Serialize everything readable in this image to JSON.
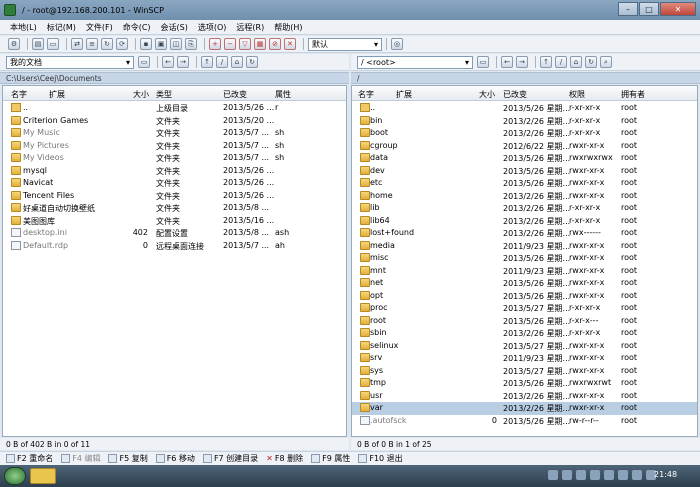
{
  "window": {
    "title": "/ - root@192.168.200.101 - WinSCP"
  },
  "menu": [
    "本地(L)",
    "标记(M)",
    "文件(F)",
    "命令(C)",
    "会话(S)",
    "选项(O)",
    "远程(R)",
    "帮助(H)"
  ],
  "toolbar": {
    "preset": "默认"
  },
  "left": {
    "path_select": "我的文档",
    "address": "C:\\Users\\Ceej\\Documents",
    "headers": {
      "name": "名字",
      "ext": "扩展",
      "size": "大小",
      "type": "类型",
      "changed": "已改变",
      "attr": "属性"
    },
    "rows": [
      {
        "name": "..",
        "size": "",
        "type": "上级目录",
        "changed": "2013/5/26 ...",
        "attr": "r",
        "icon": "up",
        "dim": false
      },
      {
        "name": "Criterion Games",
        "size": "",
        "type": "文件夹",
        "changed": "2013/5/20 ...",
        "attr": "",
        "icon": "folder",
        "dim": false
      },
      {
        "name": "My Music",
        "size": "",
        "type": "文件夹",
        "changed": "2013/5/7 ...",
        "attr": "sh",
        "icon": "folder",
        "dim": true
      },
      {
        "name": "My Pictures",
        "size": "",
        "type": "文件夹",
        "changed": "2013/5/7 ...",
        "attr": "sh",
        "icon": "folder",
        "dim": true
      },
      {
        "name": "My Videos",
        "size": "",
        "type": "文件夹",
        "changed": "2013/5/7 ...",
        "attr": "sh",
        "icon": "folder",
        "dim": true
      },
      {
        "name": "mysql",
        "size": "",
        "type": "文件夹",
        "changed": "2013/5/26 ...",
        "attr": "",
        "icon": "folder",
        "dim": false
      },
      {
        "name": "Navicat",
        "size": "",
        "type": "文件夹",
        "changed": "2013/5/26 ...",
        "attr": "",
        "icon": "folder",
        "dim": false
      },
      {
        "name": "Tencent Files",
        "size": "",
        "type": "文件夹",
        "changed": "2013/5/26 ...",
        "attr": "",
        "icon": "folder",
        "dim": false
      },
      {
        "name": "好桌道自动切换壁纸",
        "size": "",
        "type": "文件夹",
        "changed": "2013/5/8 ...",
        "attr": "",
        "icon": "folder",
        "dim": false
      },
      {
        "name": "美图图库",
        "size": "",
        "type": "文件夹",
        "changed": "2013/5/16 ...",
        "attr": "",
        "icon": "folder",
        "dim": false
      },
      {
        "name": "desktop.ini",
        "size": "402",
        "type": "配置设置",
        "changed": "2013/5/8 ...",
        "attr": "ash",
        "icon": "file",
        "dim": true
      },
      {
        "name": "Default.rdp",
        "size": "0",
        "type": "远程桌面连接",
        "changed": "2013/5/7 ...",
        "attr": "ah",
        "icon": "file",
        "dim": true
      }
    ],
    "status": "0 B of 402 B in 0 of 11"
  },
  "right": {
    "path_select": "/ <root>",
    "address": "/",
    "headers": {
      "name": "名字",
      "ext": "扩展",
      "size": "大小",
      "changed": "已改变",
      "rights": "权限",
      "owner": "拥有者"
    },
    "rows": [
      {
        "name": "..",
        "size": "",
        "changed": "2013/5/26 星期...",
        "rights": "r-xr-xr-x",
        "owner": "root",
        "icon": "up",
        "dim": false
      },
      {
        "name": "bin",
        "size": "",
        "changed": "2013/2/26 星期...",
        "rights": "r-xr-xr-x",
        "owner": "root",
        "icon": "folder",
        "dim": false
      },
      {
        "name": "boot",
        "size": "",
        "changed": "2013/2/26 星期...",
        "rights": "r-xr-xr-x",
        "owner": "root",
        "icon": "folder",
        "dim": false
      },
      {
        "name": "cgroup",
        "size": "",
        "changed": "2012/6/22 星期...",
        "rights": "rwxr-xr-x",
        "owner": "root",
        "icon": "folder",
        "dim": false
      },
      {
        "name": "data",
        "size": "",
        "changed": "2013/5/26 星期...",
        "rights": "rwxrwxrwx",
        "owner": "root",
        "icon": "folder",
        "dim": false
      },
      {
        "name": "dev",
        "size": "",
        "changed": "2013/5/26 星期...",
        "rights": "rwxr-xr-x",
        "owner": "root",
        "icon": "folder",
        "dim": false
      },
      {
        "name": "etc",
        "size": "",
        "changed": "2013/5/26 星期...",
        "rights": "rwxr-xr-x",
        "owner": "root",
        "icon": "folder",
        "dim": false
      },
      {
        "name": "home",
        "size": "",
        "changed": "2013/2/26 星期...",
        "rights": "rwxr-xr-x",
        "owner": "root",
        "icon": "folder",
        "dim": false
      },
      {
        "name": "lib",
        "size": "",
        "changed": "2013/2/26 星期...",
        "rights": "r-xr-xr-x",
        "owner": "root",
        "icon": "folder",
        "dim": false
      },
      {
        "name": "lib64",
        "size": "",
        "changed": "2013/2/26 星期...",
        "rights": "r-xr-xr-x",
        "owner": "root",
        "icon": "folder",
        "dim": false
      },
      {
        "name": "lost+found",
        "size": "",
        "changed": "2013/2/26 星期...",
        "rights": "rwx------",
        "owner": "root",
        "icon": "folder",
        "dim": false
      },
      {
        "name": "media",
        "size": "",
        "changed": "2011/9/23 星期...",
        "rights": "rwxr-xr-x",
        "owner": "root",
        "icon": "folder",
        "dim": false
      },
      {
        "name": "misc",
        "size": "",
        "changed": "2013/5/26 星期...",
        "rights": "rwxr-xr-x",
        "owner": "root",
        "icon": "folder",
        "dim": false
      },
      {
        "name": "mnt",
        "size": "",
        "changed": "2011/9/23 星期...",
        "rights": "rwxr-xr-x",
        "owner": "root",
        "icon": "folder",
        "dim": false
      },
      {
        "name": "net",
        "size": "",
        "changed": "2013/5/26 星期...",
        "rights": "rwxr-xr-x",
        "owner": "root",
        "icon": "folder",
        "dim": false
      },
      {
        "name": "opt",
        "size": "",
        "changed": "2013/5/26 星期...",
        "rights": "rwxr-xr-x",
        "owner": "root",
        "icon": "folder",
        "dim": false
      },
      {
        "name": "proc",
        "size": "",
        "changed": "2013/5/27 星期...",
        "rights": "r-xr-xr-x",
        "owner": "root",
        "icon": "folder",
        "dim": false
      },
      {
        "name": "root",
        "size": "",
        "changed": "2013/5/26 星期...",
        "rights": "r-xr-x---",
        "owner": "root",
        "icon": "folder",
        "dim": false
      },
      {
        "name": "sbin",
        "size": "",
        "changed": "2013/2/26 星期...",
        "rights": "r-xr-xr-x",
        "owner": "root",
        "icon": "folder",
        "dim": false
      },
      {
        "name": "selinux",
        "size": "",
        "changed": "2013/5/27 星期...",
        "rights": "rwxr-xr-x",
        "owner": "root",
        "icon": "folder",
        "dim": false
      },
      {
        "name": "srv",
        "size": "",
        "changed": "2011/9/23 星期...",
        "rights": "rwxr-xr-x",
        "owner": "root",
        "icon": "folder",
        "dim": false
      },
      {
        "name": "sys",
        "size": "",
        "changed": "2013/5/27 星期...",
        "rights": "rwxr-xr-x",
        "owner": "root",
        "icon": "folder",
        "dim": false
      },
      {
        "name": "tmp",
        "size": "",
        "changed": "2013/5/26 星期...",
        "rights": "rwxrwxrwt",
        "owner": "root",
        "icon": "folder",
        "dim": false
      },
      {
        "name": "usr",
        "size": "",
        "changed": "2013/2/26 星期...",
        "rights": "rwxr-xr-x",
        "owner": "root",
        "icon": "folder",
        "dim": false
      },
      {
        "name": "var",
        "size": "",
        "changed": "2013/2/26 星期...",
        "rights": "rwxr-xr-x",
        "owner": "root",
        "icon": "folder",
        "dim": false,
        "selected": true
      },
      {
        "name": ".autofsck",
        "size": "0",
        "changed": "2013/5/26 星期...",
        "rights": "rw-r--r--",
        "owner": "root",
        "icon": "file",
        "dim": true
      }
    ],
    "status": "0 B of 0 B in 1 of 25"
  },
  "fkeys": [
    {
      "label": "F2 重命名",
      "enabled": true
    },
    {
      "label": "F4 编辑",
      "enabled": false
    },
    {
      "label": "F5 复制",
      "enabled": true
    },
    {
      "label": "F6 移动",
      "enabled": true
    },
    {
      "label": "F7 创建目录",
      "enabled": true
    },
    {
      "label": "F8 删除",
      "enabled": true
    },
    {
      "label": "F9 属性",
      "enabled": true
    },
    {
      "label": "F10 退出",
      "enabled": true
    }
  ],
  "taskbar": {
    "clock": "21:48"
  },
  "colors": {
    "selection": "#b9cde3",
    "title_bg": "#7f9cb8",
    "panel_header": "#c7d6e6"
  }
}
